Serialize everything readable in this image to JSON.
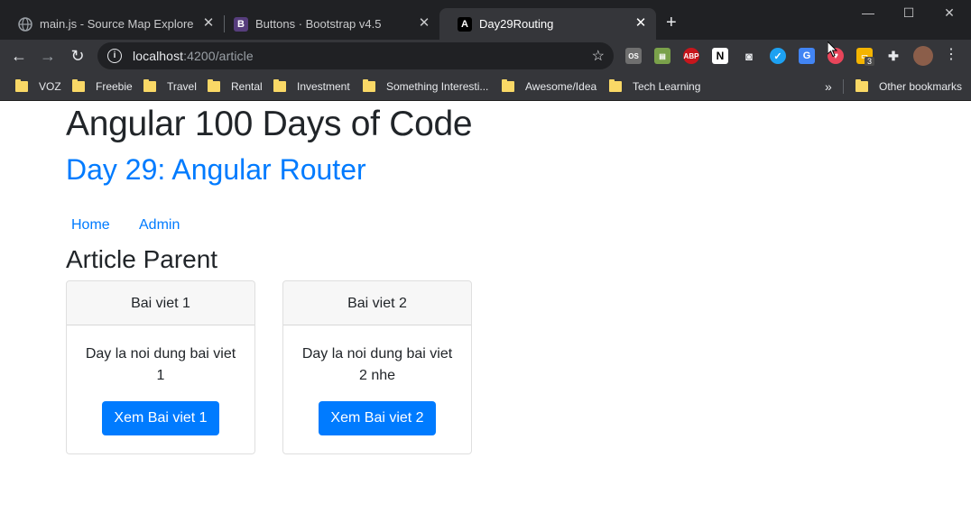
{
  "browser": {
    "tabs": [
      {
        "title": "main.js - Source Map Explorer",
        "icon": "globe-icon"
      },
      {
        "title": "Buttons · Bootstrap v4.5",
        "icon": "bootstrap-icon",
        "icon_glyph": "B"
      },
      {
        "title": "Day29Routing",
        "icon": "angular-icon",
        "icon_glyph": "A"
      }
    ],
    "active_tab": 2,
    "url_host": "localhost",
    "url_rest": ":4200/article",
    "extension_badge": "3",
    "bookmarks": [
      "VOZ",
      "Freebie",
      "Travel",
      "Rental",
      "Investment",
      "Something Interesti...",
      "Awesome/Idea",
      "Tech Learning"
    ],
    "bookmarks_overflow": "»",
    "other_bookmarks": "Other bookmarks",
    "colors": {
      "frame": "#202124",
      "toolbar": "#35363a",
      "folder": "#f9d866"
    }
  },
  "page": {
    "title": "Angular 100 Days of Code",
    "subtitle": "Day 29: Angular Router",
    "nav": [
      "Home",
      "Admin"
    ],
    "section_title": "Article Parent",
    "cards": [
      {
        "header": "Bai viet 1",
        "text": "Day la noi dung bai viet 1",
        "button": "Xem Bai viet 1"
      },
      {
        "header": "Bai viet 2",
        "text": "Day la noi dung bai viet 2 nhe",
        "button": "Xem Bai viet 2"
      }
    ],
    "colors": {
      "primary": "#007bff",
      "text": "#212529"
    }
  }
}
